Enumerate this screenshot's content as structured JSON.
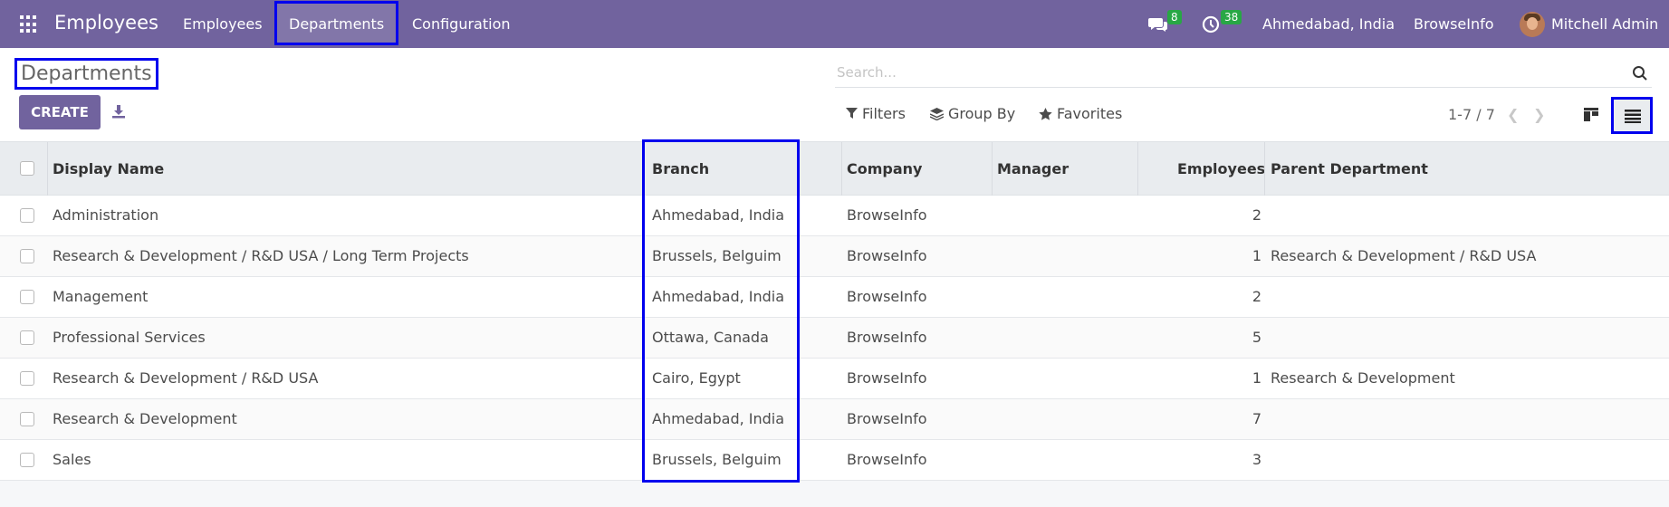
{
  "navbar": {
    "app_title": "Employees",
    "menu": [
      "Employees",
      "Departments",
      "Configuration"
    ],
    "messages_count": "8",
    "activities_count": "38",
    "branch": "Ahmedabad, India",
    "company": "BrowseInfo",
    "user": "Mitchell Admin",
    "bg_color": "#71639e"
  },
  "control_panel": {
    "title": "Departments",
    "search_placeholder": "Search...",
    "create_label": "CREATE",
    "filters_label": "Filters",
    "groupby_label": "Group By",
    "favorites_label": "Favorites",
    "pager": "1-7 / 7"
  },
  "table": {
    "headers": {
      "name": "Display Name",
      "branch": "Branch",
      "company": "Company",
      "manager": "Manager",
      "employees": "Employees",
      "parent": "Parent Department"
    },
    "rows": [
      {
        "name": "Administration",
        "branch": "Ahmedabad, India",
        "company": "BrowseInfo",
        "manager": "",
        "employees": "2",
        "parent": ""
      },
      {
        "name": "Research & Development / R&D USA / Long Term Projects",
        "branch": "Brussels, Belguim",
        "company": "BrowseInfo",
        "manager": "",
        "employees": "1",
        "parent": "Research & Development / R&D USA"
      },
      {
        "name": "Management",
        "branch": "Ahmedabad, India",
        "company": "BrowseInfo",
        "manager": "",
        "employees": "2",
        "parent": ""
      },
      {
        "name": "Professional Services",
        "branch": "Ottawa, Canada",
        "company": "BrowseInfo",
        "manager": "",
        "employees": "5",
        "parent": ""
      },
      {
        "name": "Research & Development / R&D USA",
        "branch": "Cairo, Egypt",
        "company": "BrowseInfo",
        "manager": "",
        "employees": "1",
        "parent": "Research & Development"
      },
      {
        "name": "Research & Development",
        "branch": "Ahmedabad, India",
        "company": "BrowseInfo",
        "manager": "",
        "employees": "7",
        "parent": ""
      },
      {
        "name": "Sales",
        "branch": "Brussels, Belguim",
        "company": "BrowseInfo",
        "manager": "",
        "employees": "3",
        "parent": ""
      }
    ]
  },
  "highlight_color": "#0000ee"
}
